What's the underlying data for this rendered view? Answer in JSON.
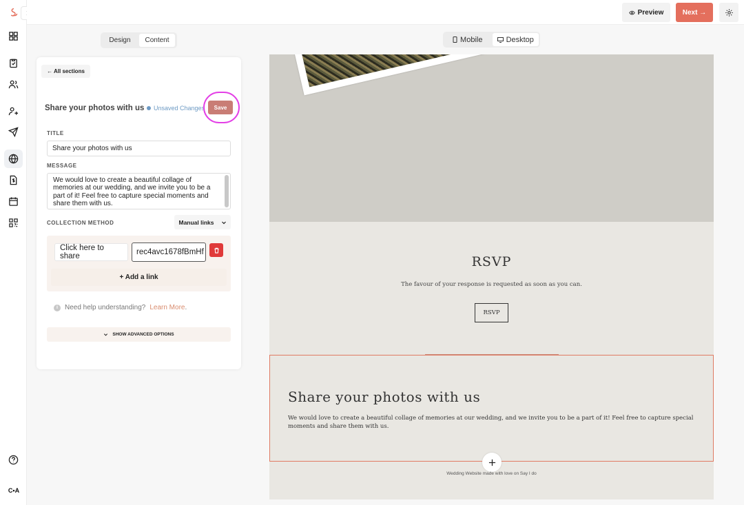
{
  "topbar": {
    "preview_label": "Preview",
    "next_label": "Next →"
  },
  "rail": {
    "items": [
      "logo-icon",
      "dashboard-icon",
      "checklist-icon",
      "guests-icon",
      "user-add-icon",
      "send-icon",
      "globe-icon",
      "document-dollar-icon",
      "calendar-icon",
      "qr-code-icon",
      "help-icon"
    ],
    "active": "globe-icon",
    "avatar_initials": "C•A"
  },
  "mode_toggle": {
    "options": [
      "Design",
      "Content"
    ],
    "selected": "Content"
  },
  "device_toggle": {
    "options": [
      "Mobile",
      "Desktop"
    ],
    "selected": "Desktop"
  },
  "panel": {
    "back_label": "← All sections",
    "section_title": "Share your photos with us",
    "unsaved_label": "Unsaved Changes",
    "save_label": "Save",
    "title_label": "TITLE",
    "title_value": "Share your photos with us",
    "message_label": "MESSAGE",
    "message_value": "We would love to create a beautiful collage of memories at our wedding, and we invite you to be a part of it! Feel free to capture special moments and share them with us.",
    "collection_label": "COLLECTION METHOD",
    "collection_value": "Manual links",
    "link": {
      "name": "Click here to share",
      "url": "rec4avc1678fBmHf"
    },
    "add_link_label": "+ Add a link",
    "help_text": "Need help understanding?",
    "learn_more": "Learn More",
    "help_period": ".",
    "advanced_label": "SHOW ADVANCED OPTIONS"
  },
  "site": {
    "rsvp_title": "RSVP",
    "rsvp_subtitle": "The favour of your response is requested as soon as you can.",
    "rsvp_button": "RSVP",
    "share_title": "Share your photos with us",
    "share_message": "We would love to create a beautiful collage of memories at our wedding, and we invite you to be a part of it! Feel free to capture special moments and share them with us.",
    "footer": "Wedding Website made with love on Say I do"
  },
  "colors": {
    "accent": "#e46f5d",
    "save": "#c97d75",
    "highlight_ring": "#e33fe6",
    "unsaved": "#6d9ac4",
    "delete": "#e03a3a"
  }
}
